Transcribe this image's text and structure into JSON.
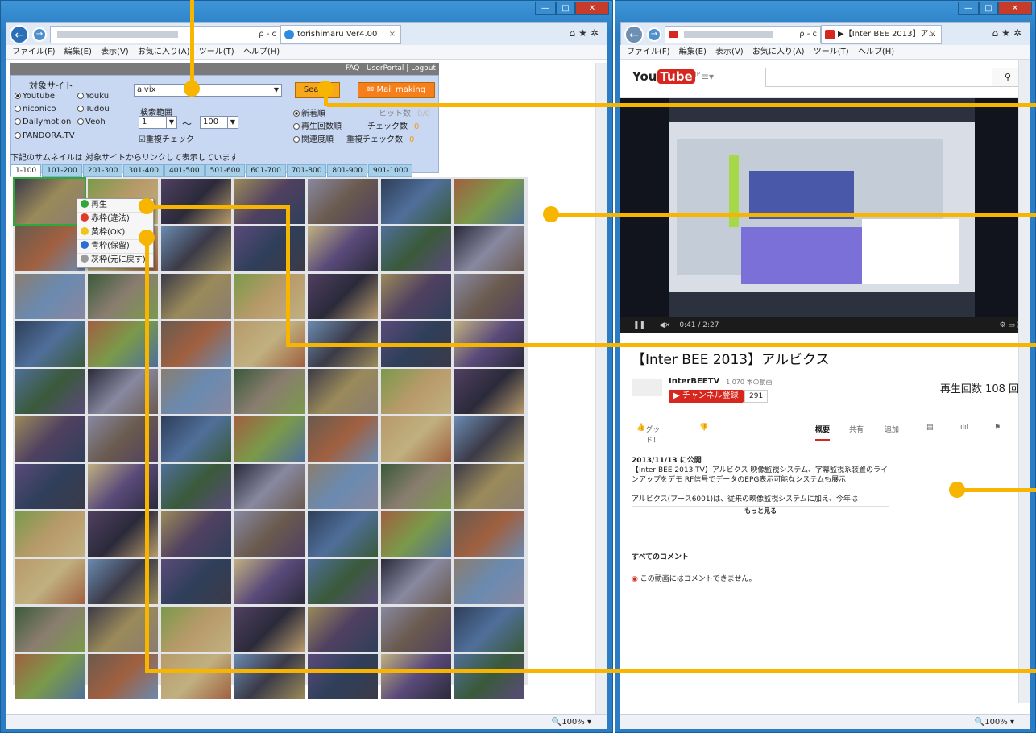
{
  "left_browser": {
    "tab_title": "torishimaru Ver4.00",
    "menu": [
      "ファイル(F)",
      "編集(E)",
      "表示(V)",
      "お気に入り(A)",
      "ツール(T)",
      "ヘルプ(H)"
    ],
    "address_controls": "ρ - c",
    "zoom": "100%",
    "header_links": "FAQ | UserPortal | Logout",
    "search": {
      "target_label": "対象サイト",
      "sites": [
        "Youtube",
        "Youku",
        "niconico",
        "Tudou",
        "Dailymotion",
        "Veoh",
        "PANDORA.TV"
      ],
      "keyword": "alvix",
      "search_button": "Search",
      "mail_button": "Mail making",
      "range_label": "検索範囲",
      "range_from": "1",
      "range_sep": "～",
      "range_to": "100",
      "dup_check": "重複チェック",
      "sort_options": [
        "新着順",
        "再生回数順",
        "関連度順"
      ],
      "hit_label": "ヒット数",
      "hit_value": "0/0",
      "check_label": "チェック数",
      "check_value": "0",
      "dup_check_label": "重複チェック数",
      "dup_check_value": "0"
    },
    "thumbnail_note": "下記のサムネイルは 対象サイトからリンクして表示しています",
    "page_tabs": [
      "1-100",
      "101-200",
      "201-300",
      "301-400",
      "401-500",
      "501-600",
      "601-700",
      "701-800",
      "801-900",
      "901-1000"
    ],
    "context_menu": [
      {
        "label": "再生",
        "color": "#2ea83b"
      },
      {
        "label": "赤枠(違法)",
        "color": "#e03a2c"
      },
      {
        "label": "黄枠(OK)",
        "color": "#f0c419"
      },
      {
        "label": "青枠(保留)",
        "color": "#2b6ed6"
      },
      {
        "label": "灰枠(元に戻す)",
        "color": "#9a9a9a"
      }
    ]
  },
  "right_browser": {
    "tab_title": "▶【Inter BEE 2013】ア...",
    "menu": [
      "ファイル(F)",
      "編集(E)",
      "表示(V)",
      "お気に入り(A)",
      "ツール(T)",
      "ヘルプ(H)"
    ],
    "address_controls": "ρ - c",
    "zoom": "100%",
    "logo_you": "You",
    "logo_tube": "Tube",
    "logo_region": "JP",
    "time": "0:41 / 2:27",
    "video_title": "【Inter BEE 2013】アルビクス",
    "channel_name": "InterBEETV",
    "channel_videos": "· 1,070 本の動画",
    "subscribe": "チャンネル登録",
    "subscribers": "291",
    "views": "再生回数 108 回",
    "like": "グッド！",
    "tabs": [
      "概要",
      "共有",
      "追加"
    ],
    "published": "2013/11/13 に公開",
    "description": "【Inter BEE 2013 TV】アルビクス  映像監視システム、字幕監視系装置のラインアップをデモ  RF信号でデータのEPG表示可能なシステムも展示",
    "description2": "アルビクス(ブース6001)は、従来の映像監視システムに加え、今年は",
    "more": "もっと見る",
    "comments_header": "すべてのコメント",
    "comments_disabled": "この動画にはコメントできません。"
  }
}
